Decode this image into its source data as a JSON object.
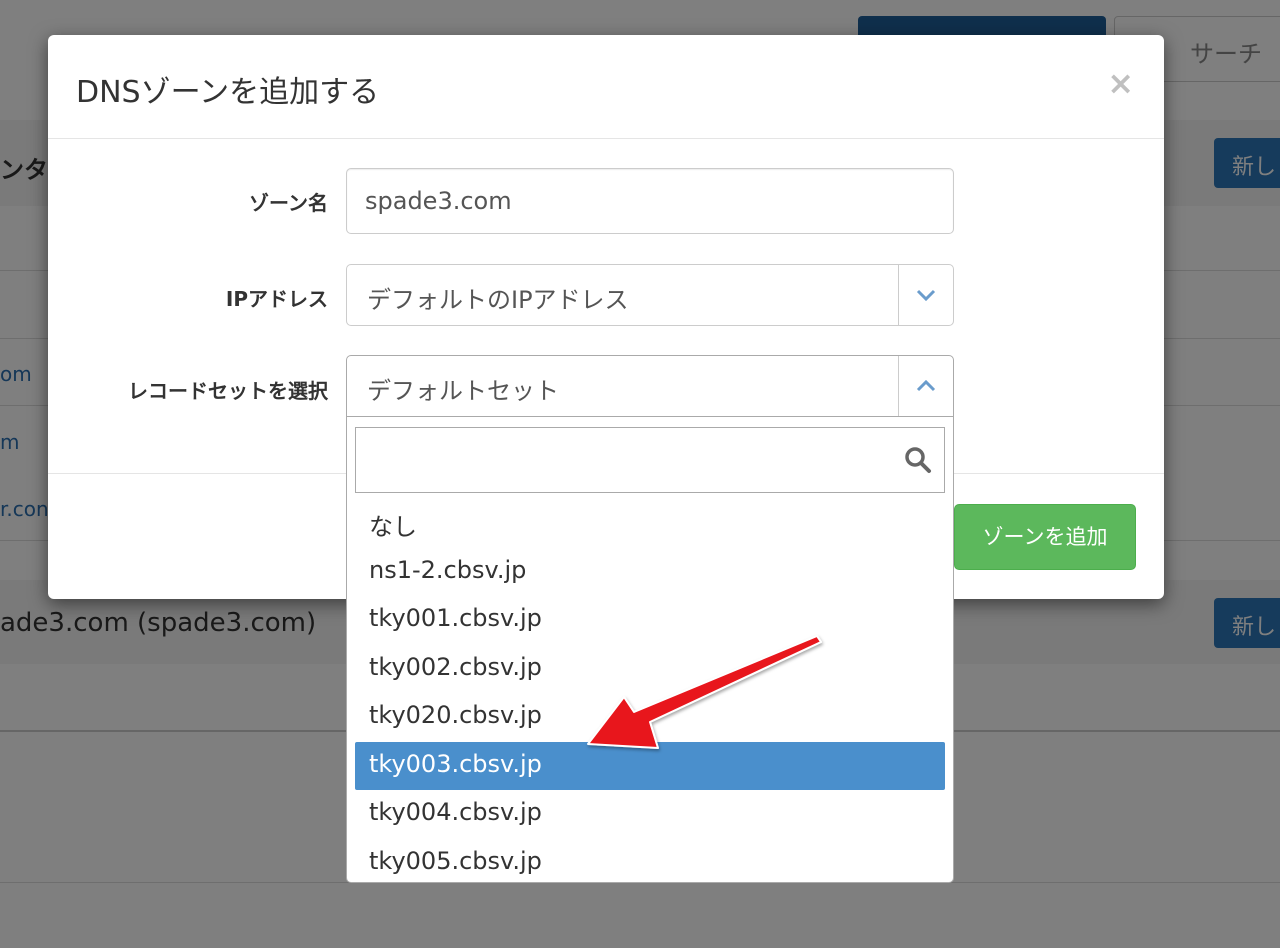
{
  "background": {
    "search_tab_label": "サーチ",
    "section1_title": "ンタ",
    "section2_title": "ade3.com (spade3.com)",
    "new_button_label": "新し",
    "links": [
      "om",
      "m",
      "r.con"
    ]
  },
  "modal": {
    "title": "DNSゾーンを追加する",
    "close_label": "×",
    "fields": {
      "zone_name": {
        "label": "ゾーン名",
        "value": "spade3.com"
      },
      "ip_address": {
        "label": "IPアドレス",
        "selected": "デフォルトのIPアドレス"
      },
      "record_set": {
        "label": "レコードセットを選択",
        "selected": "デフォルトセット"
      }
    },
    "submit_label": "ゾーンを追加"
  },
  "dropdown": {
    "search_value": "",
    "options": [
      {
        "label": "なし",
        "selected": false
      },
      {
        "label": "ns1-2.cbsv.jp",
        "selected": false
      },
      {
        "label": "tky001.cbsv.jp",
        "selected": false
      },
      {
        "label": "tky002.cbsv.jp",
        "selected": false
      },
      {
        "label": "tky020.cbsv.jp",
        "selected": false
      },
      {
        "label": "tky003.cbsv.jp",
        "selected": true
      },
      {
        "label": "tky004.cbsv.jp",
        "selected": false
      },
      {
        "label": "tky005.cbsv.jp",
        "selected": false
      }
    ]
  },
  "colors": {
    "primary": "#2c76b8",
    "success": "#5cb85c",
    "highlight": "#4a8fcc",
    "annotation": "#e8131c"
  },
  "icons": {
    "search": "search-icon",
    "chevron_down": "chevron-down-icon",
    "chevron_up": "chevron-up-icon",
    "close": "close-icon",
    "annotation": "red-arrow-annotation"
  }
}
